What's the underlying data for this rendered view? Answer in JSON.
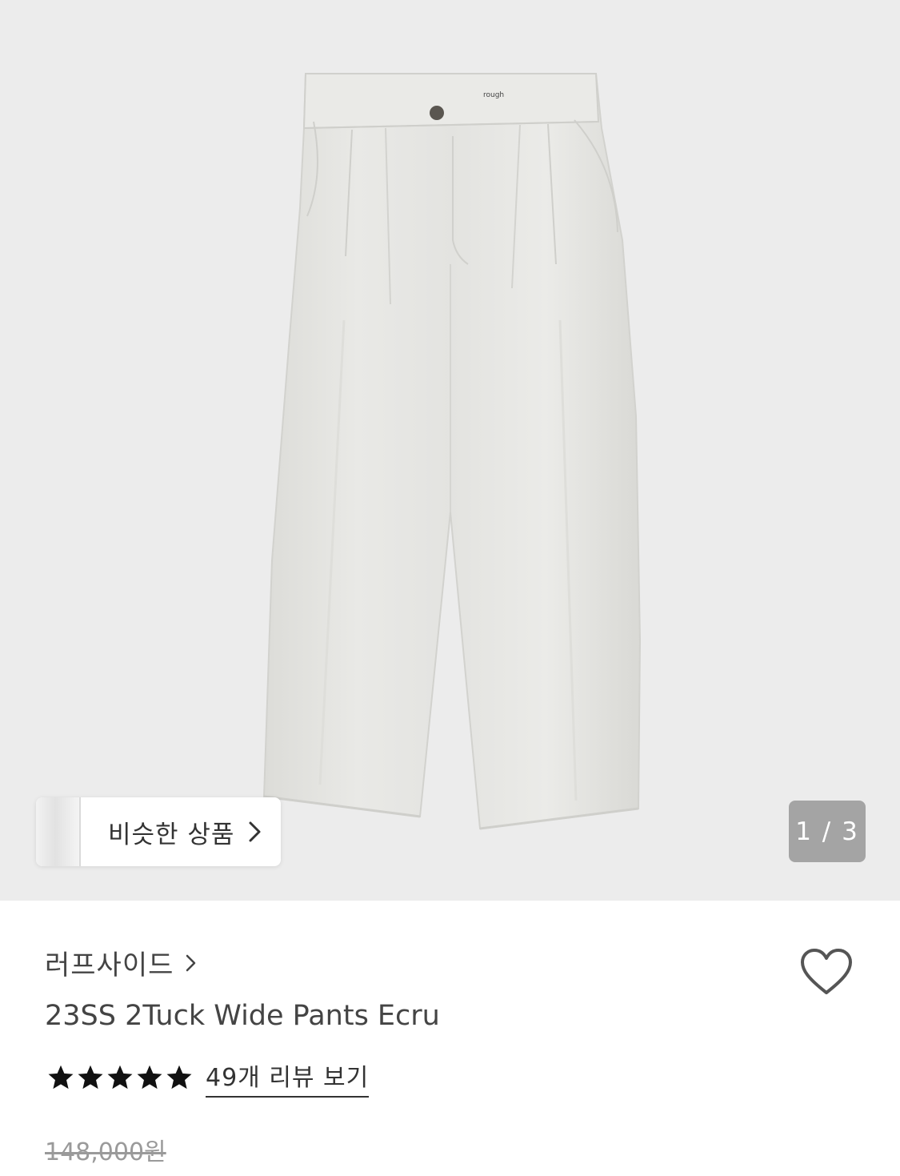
{
  "gallery": {
    "similar_label": "비슷한 상품",
    "counter": "1 / 3",
    "garment_tag": "rough"
  },
  "product": {
    "brand": "러프사이드",
    "title": "23SS 2Tuck Wide Pants Ecru",
    "rating_stars": 5,
    "review_link": "49개 리뷰 보기",
    "original_price": "148,000원"
  },
  "colors": {
    "image_bg": "#ececec",
    "pants": "#e6e6e3",
    "text_primary": "#444444",
    "price_strike": "#9a9a9a",
    "star": "#111111"
  },
  "icons": {
    "heart": "heart-outline-icon",
    "brand_arrow": "chevron-right-icon",
    "similar_arrow": "chevron-right-icon",
    "star": "star-filled-icon"
  }
}
